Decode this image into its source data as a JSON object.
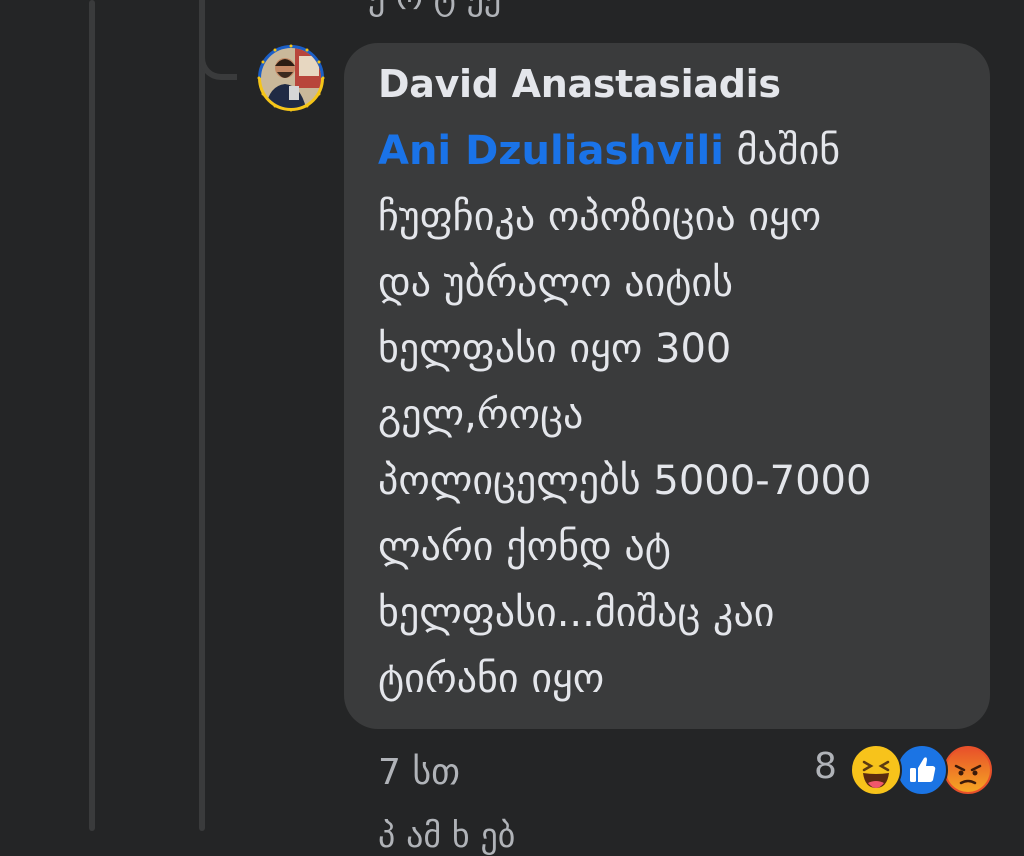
{
  "comment": {
    "author": "David Anastasiadis",
    "mention": "Ani Dzuliashvili",
    "lines": [
      " მაშინ",
      "ჩუფჩიკა ოპოზიცია იყო",
      "და უბრალო აიტის",
      "ხელფასი იყო 300",
      "გელ,როცა",
      "პოლიცელებს 5000-7000",
      "ლარი ქონდ ატ",
      "ხელფასი...მიშაც კაი",
      "ტირანი იყო"
    ],
    "time": "7 სთ",
    "reaction_count": "8",
    "reactions": [
      "haha-icon",
      "like-icon",
      "angry-icon"
    ]
  },
  "partial_top_text": "ე ო ტ ეე",
  "partial_bottom_text": "პ ამ ხ ებ",
  "colors": {
    "background": "#242526",
    "bubble": "#3a3b3c",
    "mention": "#1a73e8",
    "text": "#e4e6eb",
    "secondary_text": "#b0b3b8"
  }
}
